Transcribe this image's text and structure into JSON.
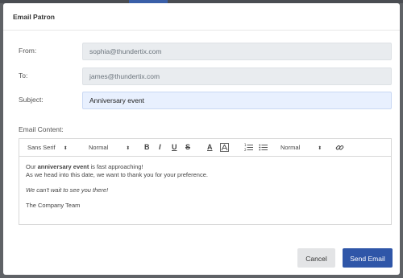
{
  "dialog": {
    "title": "Email Patron"
  },
  "form": {
    "from_label": "From:",
    "from_value": "sophia@thundertix.com",
    "to_label": "To:",
    "to_value": "james@thundertix.com",
    "subject_label": "Subject:",
    "subject_value": "Anniversary event",
    "content_label": "Email Content:"
  },
  "toolbar": {
    "font_select": "Sans Serif",
    "size_select": "Normal",
    "bold_label": "B",
    "italic_label": "I",
    "underline_label": "U",
    "strike_label": "S",
    "color_label": "A",
    "background_label": "A",
    "header_select": "Normal"
  },
  "editor": {
    "line1_prefix": "Our ",
    "line1_bold": "anniversary event",
    "line1_suffix": " is fast approaching!",
    "line2": "As we head into this date, we want to thank you for your preference.",
    "line3": "We can't wait to see you there!",
    "line4": "The Company Team"
  },
  "actions": {
    "cancel_label": "Cancel",
    "send_label": "Send Email"
  },
  "colors": {
    "primary": "#2f56a8",
    "subject_bg": "#e8f0fe",
    "readonly_bg": "#e9ecef"
  }
}
